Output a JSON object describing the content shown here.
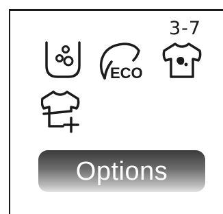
{
  "panel": {
    "range_label": "3-7",
    "eco_text": "ECO",
    "options": [
      {
        "icon": "intensive-cycle-icon"
      },
      {
        "icon": "eco-leaf-icon"
      },
      {
        "icon": "stain-shirt-icon"
      },
      {
        "icon": "extra-shirt-plus-icon"
      }
    ],
    "options_button": "Options"
  },
  "colors": {
    "frame": "#1a1a1a",
    "icon": "#1b1b1b",
    "button_top": "#3a3a3a",
    "button_bottom": "#e3e3e3",
    "button_text": "#ffffff"
  }
}
